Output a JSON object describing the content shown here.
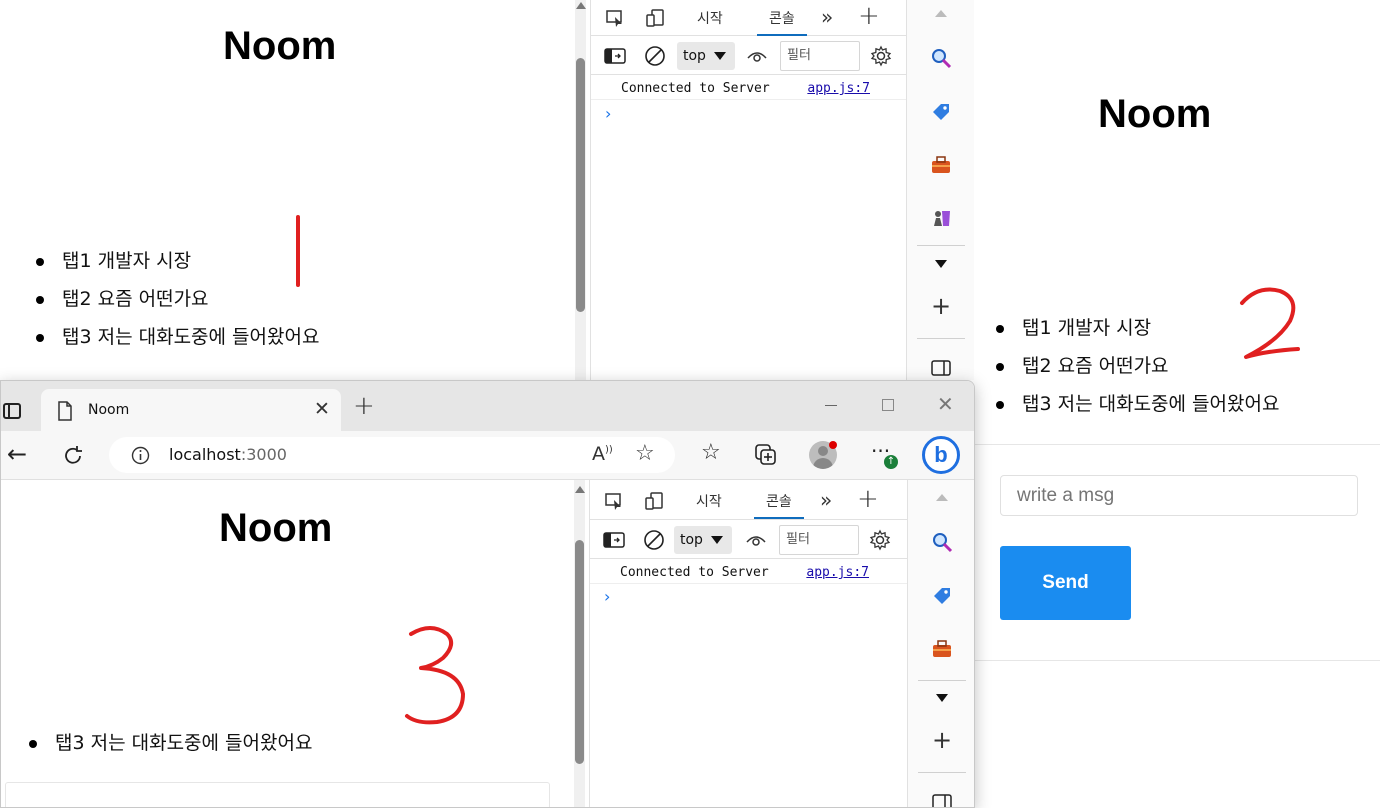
{
  "page": {
    "title": "Noom",
    "messages": [
      "탭1 개발자 시장",
      "탭2 요즘 어떤가요",
      "탭3 저는 대화도중에 들어왔어요"
    ]
  },
  "window3": {
    "title": "Noom",
    "messages": [
      "탭3 저는 대화도중에 들어왔어요"
    ]
  },
  "right": {
    "title": "Noom",
    "messages": [
      "탭1 개발자 시장",
      "탭2 요즘 어떤가요",
      "탭3 저는 대화도중에 들어왔어요"
    ],
    "input_placeholder": "write a msg",
    "send_label": "Send"
  },
  "devtools": {
    "tab_welcome": "시작",
    "tab_console": "콘솔",
    "context": "top",
    "filter_placeholder": "필터",
    "log_message": "Connected to Server",
    "log_source": "app.js:7"
  },
  "browser": {
    "tab_title": "Noom",
    "url_host": "localhost",
    "url_port": ":3000"
  },
  "annotations": {
    "one": "1",
    "two": "2",
    "three": "3"
  },
  "colors": {
    "accent": "#1a8cf0",
    "annotation": "#e02020",
    "link": "#1a0dab"
  }
}
